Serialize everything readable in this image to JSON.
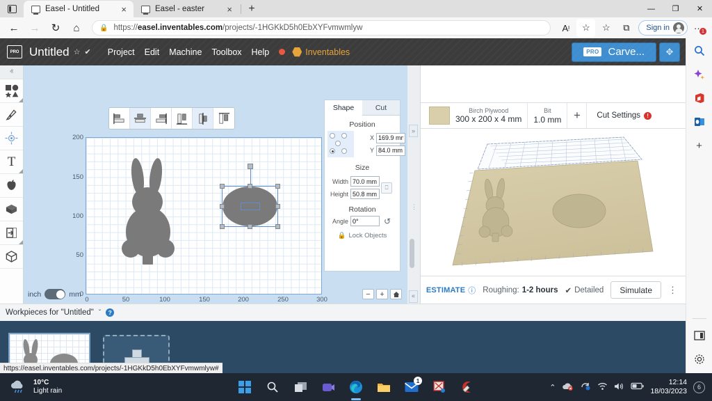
{
  "browser": {
    "tabs": [
      {
        "title": "Easel - Untitled",
        "close": "×",
        "active": true
      },
      {
        "title": "Easel - easter",
        "close": "×",
        "active": false
      }
    ],
    "new_tab_label": "+",
    "window_controls": {
      "minimize": "—",
      "maximize": "❐",
      "close": "✕"
    },
    "nav": {
      "back": "←",
      "forward": "→",
      "reload": "↻",
      "home": "⌂"
    },
    "address": {
      "lock_icon": "lock-icon",
      "url_prefix": "https://",
      "url_domain": "easel.inventables.com",
      "url_path": "/projects/-1HGKkD5h0EbXYFvmwmlyw"
    },
    "toolbar_buttons": [
      {
        "name": "read-aloud-icon",
        "glyph": "Aᵎ"
      },
      {
        "name": "add-favorite-icon",
        "glyph": "☆"
      },
      {
        "name": "favorites-icon",
        "glyph": "☆"
      },
      {
        "name": "collections-icon",
        "glyph": "⧉"
      }
    ],
    "sign_in_label": "Sign in",
    "more_menu": "···",
    "more_badge": "1",
    "status_url": "https://easel.inventables.com/projects/-1HGKkD5h0EbXYFvmwmlyw#"
  },
  "edge_sidebar": {
    "items": [
      {
        "name": "search-icon",
        "glyph": "⚲"
      },
      {
        "name": "copilot-sparkle-icon",
        "glyph": "✦"
      },
      {
        "name": "office-icon",
        "glyph": "⬢"
      },
      {
        "name": "outlook-icon",
        "glyph": "⬟"
      },
      {
        "name": "add-sidebar-app-icon",
        "glyph": "+"
      }
    ],
    "bottom": [
      {
        "name": "split-screen-icon",
        "glyph": "▤"
      },
      {
        "name": "sidebar-settings-icon",
        "glyph": "⚙"
      }
    ]
  },
  "easel": {
    "logo_text": "PRO",
    "doc_title": "Untitled",
    "star_icon": "☆",
    "saved_icon": "✔",
    "menu": [
      "Project",
      "Edit",
      "Machine",
      "Toolbox",
      "Help"
    ],
    "help_status_dot": "unsaved-indicator",
    "inventables_label": "Inventables",
    "carve_button": {
      "badge": "PRO",
      "label": "Carve..."
    },
    "expand_button": "✥"
  },
  "tool_rail": {
    "collapse_glyph": "ⱏ",
    "tools": [
      {
        "name": "shapes-tool",
        "glyph": "shapes",
        "has_corner": true
      },
      {
        "name": "pen-tool",
        "glyph": "pen",
        "has_corner": false
      },
      {
        "name": "center-point-tool",
        "glyph": "center",
        "has_corner": false
      },
      {
        "name": "text-tool",
        "glyph": "T",
        "has_corner": true
      },
      {
        "name": "apps-apple-tool",
        "glyph": "apple",
        "has_corner": false
      },
      {
        "name": "projects-box-tool",
        "glyph": "box",
        "has_corner": false
      },
      {
        "name": "import-tool",
        "glyph": "import",
        "has_corner": true
      },
      {
        "name": "three-d-tool",
        "glyph": "cube",
        "has_corner": false
      }
    ]
  },
  "align_toolbar": {
    "buttons": [
      {
        "name": "align-left-button",
        "active": false
      },
      {
        "name": "align-center-horizontal-button",
        "active": true
      },
      {
        "name": "align-right-button",
        "active": false
      },
      {
        "name": "align-top-button",
        "active": false
      },
      {
        "name": "align-middle-vertical-button",
        "active": true
      },
      {
        "name": "align-bottom-button",
        "active": false
      }
    ]
  },
  "canvas": {
    "y_ticks": [
      "200",
      "150",
      "100",
      "50",
      "0"
    ],
    "x_ticks": [
      "0",
      "50",
      "100",
      "150",
      "200",
      "250",
      "300"
    ],
    "unit_left": "inch",
    "unit_right": "mm",
    "unit_selected": "mm",
    "zoom_out": "−",
    "zoom_in": "+",
    "zoom_home": "⌂",
    "shapes": [
      {
        "name": "bunny-shape",
        "fill": "#7a7a7a"
      },
      {
        "name": "oval-shape",
        "fill": "#7a7a7a",
        "selected": true
      }
    ]
  },
  "shape_panel": {
    "tabs": [
      {
        "label": "Shape",
        "active": true
      },
      {
        "label": "Cut",
        "active": false
      }
    ],
    "position": {
      "title": "Position",
      "x_label": "X",
      "x_value": "169.9 mm",
      "y_label": "Y",
      "y_value": "84.0 mm",
      "anchor_selected": "bottom-left"
    },
    "size": {
      "title": "Size",
      "width_label": "Width",
      "width_value": "70.0 mm",
      "height_label": "Height",
      "height_value": "50.8 mm",
      "link_icon": "link-aspect-icon"
    },
    "rotation": {
      "title": "Rotation",
      "angle_label": "Angle",
      "angle_value": "0°",
      "reset_icon": "↺"
    },
    "lock_label": "Lock Objects",
    "lock_icon": "lock-icon",
    "collapse_glyph": "»"
  },
  "preview": {
    "material": {
      "name": "Birch Plywood",
      "dimensions": "300 x 200 x 4 mm",
      "swatch_color": "#d9cfab"
    },
    "bit": {
      "label": "Bit",
      "value": "1.0 mm"
    },
    "add_label": "+",
    "cut_settings_label": "Cut Settings",
    "cut_settings_error": "!",
    "estimate": {
      "link": "ESTIMATE",
      "info_icon": "ⓘ",
      "roughing_label": "Roughing:",
      "roughing_value": "1-2 hours",
      "detailed_check": "✔",
      "detailed_label": "Detailed",
      "simulate_label": "Simulate",
      "more_icon": "⋮"
    }
  },
  "workpieces": {
    "header": "Workpieces for \"Untitled\"",
    "chevron": "ˇ",
    "help_icon": "?",
    "cards": [
      {
        "name": "workpiece-thumbnail-1",
        "selected": true
      },
      {
        "name": "add-workpiece-card",
        "selected": false
      }
    ]
  },
  "taskbar": {
    "weather": {
      "temp": "10°C",
      "condition": "Light rain"
    },
    "apps": [
      {
        "name": "start-button",
        "glyph": "start"
      },
      {
        "name": "search-taskbar-icon",
        "glyph": "search"
      },
      {
        "name": "task-view-icon",
        "glyph": "taskview"
      },
      {
        "name": "teams-icon",
        "glyph": "teams"
      },
      {
        "name": "edge-icon",
        "glyph": "edge",
        "active": true
      },
      {
        "name": "file-explorer-icon",
        "glyph": "folder"
      },
      {
        "name": "mail-icon",
        "glyph": "mail",
        "badge": "1"
      },
      {
        "name": "snipping-tool-icon",
        "glyph": "snip"
      },
      {
        "name": "ccleaner-icon",
        "glyph": "ccleaner"
      }
    ],
    "tray": {
      "overflow": "⌃",
      "onedrive": "onedrive-icon",
      "sync": "sync-icon",
      "wifi": "◠",
      "volume": "🔊",
      "battery": "battery-icon",
      "time": "12:14",
      "date": "18/03/2023",
      "notification_count": "6"
    }
  }
}
